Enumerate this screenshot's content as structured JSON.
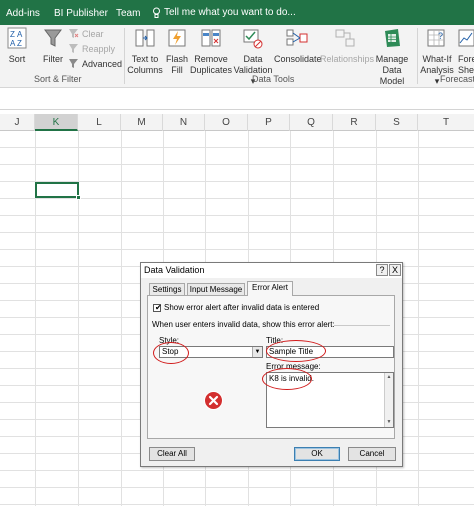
{
  "ribbon_tabs": [
    "Add-ins",
    "BI Publisher",
    "Team"
  ],
  "tell_me": "Tell me what you want to do...",
  "sort_filter": {
    "sort_label": "Sort",
    "filter_label": "Filter",
    "clear_label": "Clear",
    "reapply_label": "Reapply",
    "advanced_label": "Advanced",
    "group_label": "Sort & Filter"
  },
  "data_tools": {
    "text_to_columns": [
      "Text to",
      "Columns"
    ],
    "flash_fill": [
      "Flash",
      "Fill"
    ],
    "remove_duplicates": [
      "Remove",
      "Duplicates"
    ],
    "data_validation": [
      "Data",
      "Validation ▾"
    ],
    "consolidate": "Consolidate",
    "relationships": "Relationships",
    "manage_data_model": [
      "Manage",
      "Data Model"
    ],
    "group_label": "Data Tools"
  },
  "forecast": {
    "what_if": [
      "What-If",
      "Analysis ▾"
    ],
    "forecast_sheet": [
      "Fore",
      "She"
    ],
    "group_label": "Forecast"
  },
  "columns": [
    "J",
    "K",
    "L",
    "M",
    "N",
    "O",
    "P",
    "Q",
    "R",
    "S",
    "T"
  ],
  "active_column": "K",
  "dialog": {
    "title": "Data Validation",
    "help_button": "?",
    "close_button": "X",
    "tabs": [
      "Settings",
      "Input Message",
      "Error Alert"
    ],
    "active_tab": "Error Alert",
    "show_alert_label": "Show error alert after invalid data is entered",
    "show_alert_checked": true,
    "section_label": "When user enters invalid data, show this error alert:",
    "style_label": "Style:",
    "style_value": "Stop",
    "title_label": "Title:",
    "title_value": "Sample Title",
    "error_message_label": "Error message:",
    "error_message_value": "K8 is invalid.",
    "clear_all_label": "Clear All",
    "ok_label": "OK",
    "cancel_label": "Cancel"
  },
  "colors": {
    "excel_green": "#217346",
    "highlight_red": "#d11a1a",
    "stop_red": "#d32f2f"
  }
}
